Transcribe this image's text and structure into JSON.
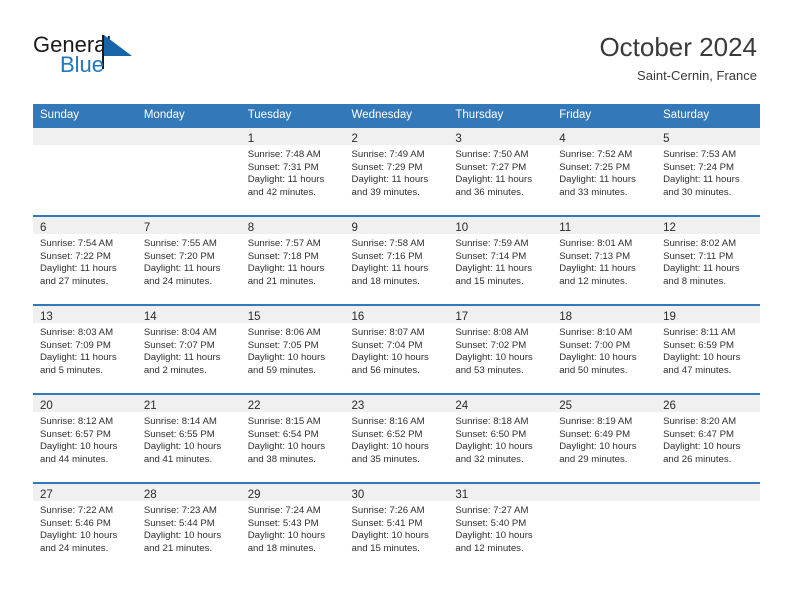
{
  "brand": {
    "name_top": "General",
    "name_bottom": "Blue",
    "flag_icon": "triangle-flag-icon",
    "accent_color": "#1f77bd"
  },
  "header": {
    "title": "October 2024",
    "subtitle": "Saint-Cernin, France"
  },
  "colors": {
    "header_row_bg": "#3378b8",
    "day_band_bg": "#f0f0f0",
    "row_separator": "#3378b8",
    "text": "#2f2f2f"
  },
  "calendar": {
    "weekday_headers": [
      "Sunday",
      "Monday",
      "Tuesday",
      "Wednesday",
      "Thursday",
      "Friday",
      "Saturday"
    ],
    "labels": {
      "sunrise": "Sunrise:",
      "sunset": "Sunset:",
      "daylight": "Daylight:"
    },
    "weeks": [
      [
        {
          "day": "",
          "lines": []
        },
        {
          "day": "",
          "lines": []
        },
        {
          "day": "1",
          "lines": [
            "Sunrise: 7:48 AM",
            "Sunset: 7:31 PM",
            "Daylight: 11 hours",
            "and 42 minutes."
          ]
        },
        {
          "day": "2",
          "lines": [
            "Sunrise: 7:49 AM",
            "Sunset: 7:29 PM",
            "Daylight: 11 hours",
            "and 39 minutes."
          ]
        },
        {
          "day": "3",
          "lines": [
            "Sunrise: 7:50 AM",
            "Sunset: 7:27 PM",
            "Daylight: 11 hours",
            "and 36 minutes."
          ]
        },
        {
          "day": "4",
          "lines": [
            "Sunrise: 7:52 AM",
            "Sunset: 7:25 PM",
            "Daylight: 11 hours",
            "and 33 minutes."
          ]
        },
        {
          "day": "5",
          "lines": [
            "Sunrise: 7:53 AM",
            "Sunset: 7:24 PM",
            "Daylight: 11 hours",
            "and 30 minutes."
          ]
        }
      ],
      [
        {
          "day": "6",
          "lines": [
            "Sunrise: 7:54 AM",
            "Sunset: 7:22 PM",
            "Daylight: 11 hours",
            "and 27 minutes."
          ]
        },
        {
          "day": "7",
          "lines": [
            "Sunrise: 7:55 AM",
            "Sunset: 7:20 PM",
            "Daylight: 11 hours",
            "and 24 minutes."
          ]
        },
        {
          "day": "8",
          "lines": [
            "Sunrise: 7:57 AM",
            "Sunset: 7:18 PM",
            "Daylight: 11 hours",
            "and 21 minutes."
          ]
        },
        {
          "day": "9",
          "lines": [
            "Sunrise: 7:58 AM",
            "Sunset: 7:16 PM",
            "Daylight: 11 hours",
            "and 18 minutes."
          ]
        },
        {
          "day": "10",
          "lines": [
            "Sunrise: 7:59 AM",
            "Sunset: 7:14 PM",
            "Daylight: 11 hours",
            "and 15 minutes."
          ]
        },
        {
          "day": "11",
          "lines": [
            "Sunrise: 8:01 AM",
            "Sunset: 7:13 PM",
            "Daylight: 11 hours",
            "and 12 minutes."
          ]
        },
        {
          "day": "12",
          "lines": [
            "Sunrise: 8:02 AM",
            "Sunset: 7:11 PM",
            "Daylight: 11 hours",
            "and 8 minutes."
          ]
        }
      ],
      [
        {
          "day": "13",
          "lines": [
            "Sunrise: 8:03 AM",
            "Sunset: 7:09 PM",
            "Daylight: 11 hours",
            "and 5 minutes."
          ]
        },
        {
          "day": "14",
          "lines": [
            "Sunrise: 8:04 AM",
            "Sunset: 7:07 PM",
            "Daylight: 11 hours",
            "and 2 minutes."
          ]
        },
        {
          "day": "15",
          "lines": [
            "Sunrise: 8:06 AM",
            "Sunset: 7:05 PM",
            "Daylight: 10 hours",
            "and 59 minutes."
          ]
        },
        {
          "day": "16",
          "lines": [
            "Sunrise: 8:07 AM",
            "Sunset: 7:04 PM",
            "Daylight: 10 hours",
            "and 56 minutes."
          ]
        },
        {
          "day": "17",
          "lines": [
            "Sunrise: 8:08 AM",
            "Sunset: 7:02 PM",
            "Daylight: 10 hours",
            "and 53 minutes."
          ]
        },
        {
          "day": "18",
          "lines": [
            "Sunrise: 8:10 AM",
            "Sunset: 7:00 PM",
            "Daylight: 10 hours",
            "and 50 minutes."
          ]
        },
        {
          "day": "19",
          "lines": [
            "Sunrise: 8:11 AM",
            "Sunset: 6:59 PM",
            "Daylight: 10 hours",
            "and 47 minutes."
          ]
        }
      ],
      [
        {
          "day": "20",
          "lines": [
            "Sunrise: 8:12 AM",
            "Sunset: 6:57 PM",
            "Daylight: 10 hours",
            "and 44 minutes."
          ]
        },
        {
          "day": "21",
          "lines": [
            "Sunrise: 8:14 AM",
            "Sunset: 6:55 PM",
            "Daylight: 10 hours",
            "and 41 minutes."
          ]
        },
        {
          "day": "22",
          "lines": [
            "Sunrise: 8:15 AM",
            "Sunset: 6:54 PM",
            "Daylight: 10 hours",
            "and 38 minutes."
          ]
        },
        {
          "day": "23",
          "lines": [
            "Sunrise: 8:16 AM",
            "Sunset: 6:52 PM",
            "Daylight: 10 hours",
            "and 35 minutes."
          ]
        },
        {
          "day": "24",
          "lines": [
            "Sunrise: 8:18 AM",
            "Sunset: 6:50 PM",
            "Daylight: 10 hours",
            "and 32 minutes."
          ]
        },
        {
          "day": "25",
          "lines": [
            "Sunrise: 8:19 AM",
            "Sunset: 6:49 PM",
            "Daylight: 10 hours",
            "and 29 minutes."
          ]
        },
        {
          "day": "26",
          "lines": [
            "Sunrise: 8:20 AM",
            "Sunset: 6:47 PM",
            "Daylight: 10 hours",
            "and 26 minutes."
          ]
        }
      ],
      [
        {
          "day": "27",
          "lines": [
            "Sunrise: 7:22 AM",
            "Sunset: 5:46 PM",
            "Daylight: 10 hours",
            "and 24 minutes."
          ]
        },
        {
          "day": "28",
          "lines": [
            "Sunrise: 7:23 AM",
            "Sunset: 5:44 PM",
            "Daylight: 10 hours",
            "and 21 minutes."
          ]
        },
        {
          "day": "29",
          "lines": [
            "Sunrise: 7:24 AM",
            "Sunset: 5:43 PM",
            "Daylight: 10 hours",
            "and 18 minutes."
          ]
        },
        {
          "day": "30",
          "lines": [
            "Sunrise: 7:26 AM",
            "Sunset: 5:41 PM",
            "Daylight: 10 hours",
            "and 15 minutes."
          ]
        },
        {
          "day": "31",
          "lines": [
            "Sunrise: 7:27 AM",
            "Sunset: 5:40 PM",
            "Daylight: 10 hours",
            "and 12 minutes."
          ]
        },
        {
          "day": "",
          "lines": []
        },
        {
          "day": "",
          "lines": []
        }
      ]
    ]
  }
}
